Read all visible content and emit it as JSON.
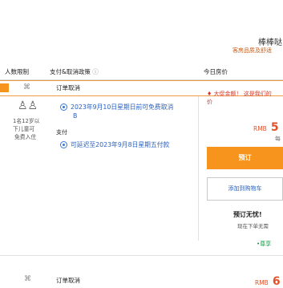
{
  "header": {
    "title": "棒棒哒",
    "subtitle": "客房品质及舒适"
  },
  "columns": {
    "occupancy": "人数限制",
    "payment_policy": "支付&取消政策",
    "policy_icon": "info-icon",
    "today_price": "今日房价"
  },
  "room1": {
    "name": "订单取消",
    "promo_tag": "♦ 大促金额！ 这是我们的",
    "promo_sub": "价",
    "capacity_line1": "1名12岁以",
    "capacity_line2": "下儿童可",
    "capacity_line3": "免费入住",
    "cancel_text": "2023年9月10日星期日前可免费取消",
    "cancel_marker": "B",
    "pay_label": "支付",
    "pay_text": "可延迟至2023年9月8日星期五付款",
    "price_currency": "RMB",
    "price_value": "5",
    "price_sub": "每",
    "book_label": "预订",
    "cart_label": "添加到购物车",
    "nopay_title": "预订无忧!",
    "nopay_sub": "现在下单无需",
    "vip_text": "•尊享"
  },
  "room2": {
    "name": "订单取消",
    "price_currency": "RMB",
    "price_value": "6"
  },
  "colors": {
    "accent": "#f7941d",
    "link": "#2b62c0",
    "price": "#e2522a",
    "promo": "#d23a2a",
    "vip": "#1a9a4a"
  }
}
